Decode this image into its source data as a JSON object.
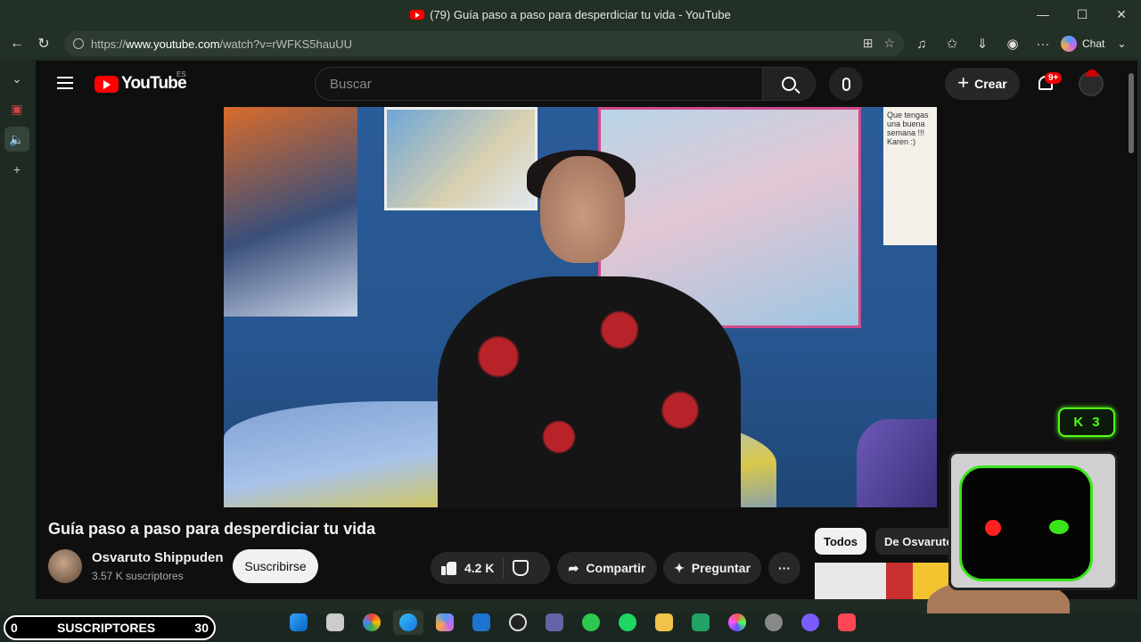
{
  "window": {
    "title": "(79) Guía paso a paso para desperdiciar tu vida - YouTube",
    "minimize": "—",
    "maximize": "☐",
    "close": "✕"
  },
  "browser": {
    "url_prefix": "https://",
    "url_domain": "www.youtube.com",
    "url_path": "/watch?v=rWFKS5hauUU",
    "chat_label": "Chat"
  },
  "youtube": {
    "logo_text": "YouTube",
    "country_code": "ES",
    "search_placeholder": "Buscar",
    "create_label": "Crear",
    "notifications_badge": "9+"
  },
  "video": {
    "title": "Guía paso a paso para desperdiciar tu vida",
    "channel_name": "Osvaruto Shippuden",
    "channel_subs": "3.57 K suscriptores",
    "subscribe_label": "Suscribirse",
    "like_count": "4.2 K",
    "share_label": "Compartir",
    "ask_label": "Preguntar",
    "memo_text": "Que tengas una buena semana !!! Karen :)"
  },
  "recommendations": {
    "chips": [
      "Todos",
      "De Osvaruto"
    ]
  },
  "overlay": {
    "subs_left": "0",
    "subs_label": "SUSCRIPTORES",
    "subs_right": "30",
    "kick_count": "3"
  },
  "colors": {
    "youtube_red": "#ff0000",
    "kick_green": "#53fc18",
    "notification_badge": "#e00000"
  }
}
